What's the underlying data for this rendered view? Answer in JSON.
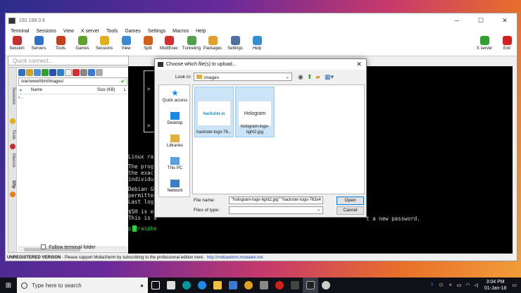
{
  "window": {
    "title": "192.168.0.6",
    "min": "─",
    "max": "☐",
    "close": "✕"
  },
  "menu": [
    "Terminal",
    "Sessions",
    "View",
    "X server",
    "Tools",
    "Games",
    "Settings",
    "Macros",
    "Help"
  ],
  "toolbar": [
    {
      "label": "Session",
      "color": "#c03030"
    },
    {
      "label": "Servers",
      "color": "#3070c0"
    },
    {
      "label": "Tools",
      "color": "#c04020"
    },
    {
      "label": "Games",
      "color": "#60a030"
    },
    {
      "label": "Sessions",
      "color": "#e0b020"
    },
    {
      "label": "View",
      "color": "#3a8ad0"
    },
    {
      "label": "Split",
      "color": "#d06020"
    },
    {
      "label": "MultiExec",
      "color": "#d03030"
    },
    {
      "label": "Tunneling",
      "color": "#50a050"
    },
    {
      "label": "Packages",
      "color": "#e0a030"
    },
    {
      "label": "Settings",
      "color": "#5070a0"
    },
    {
      "label": "Help",
      "color": "#3090d0"
    }
  ],
  "toolbar_right": [
    {
      "label": "X server",
      "color": "#30a030"
    },
    {
      "label": "Exit",
      "color": "#d02020"
    }
  ],
  "quick_connect": "Quick connect...",
  "sidebar": {
    "tabs": [
      "Sessions",
      "Tools",
      "Macros",
      "Sftp"
    ],
    "path": "/var/www/html/images/",
    "col_name": "Name",
    "col_size": "Size (KB)",
    "col_l": "L",
    "row": "..",
    "follow": "Follow terminal folder"
  },
  "terminal": {
    "lines": [
      "Linux rasp",
      "The progr",
      "the exact",
      "individua",
      "Debian GN",
      "permitted",
      "Last logi",
      "$SH is en",
      "This is a",
      "pi@raspbe"
    ],
    "tail": "t a new password."
  },
  "status": {
    "bold": "UNREGISTERED VERSION",
    "text": " -  Please support MobaXterm by subscribing to the professional edition here:",
    "link": "http://mobaxterm.mobatek.net"
  },
  "dialog": {
    "title": "Choose which file(s) to upload...",
    "look_in_label": "Look in:",
    "look_in": "images",
    "places": [
      "Quick access",
      "Desktop",
      "Libraries",
      "This PC",
      "Network"
    ],
    "files": [
      {
        "name": "hackster-logo-76...",
        "thumb": "hackster.io"
      },
      {
        "name": "hologram-logo-light2.jpg",
        "thumb": "Hologram"
      }
    ],
    "file_name_label": "File name:",
    "file_name": "\"hologram-logo-light2.jpg\" \"hackster-logo-763x4",
    "file_type_label": "Files of type:",
    "open": "Open",
    "cancel": "Cancel"
  },
  "taskbar": {
    "search": "Type here to search",
    "time": "3:04 PM",
    "date": "01-Jan-18"
  }
}
